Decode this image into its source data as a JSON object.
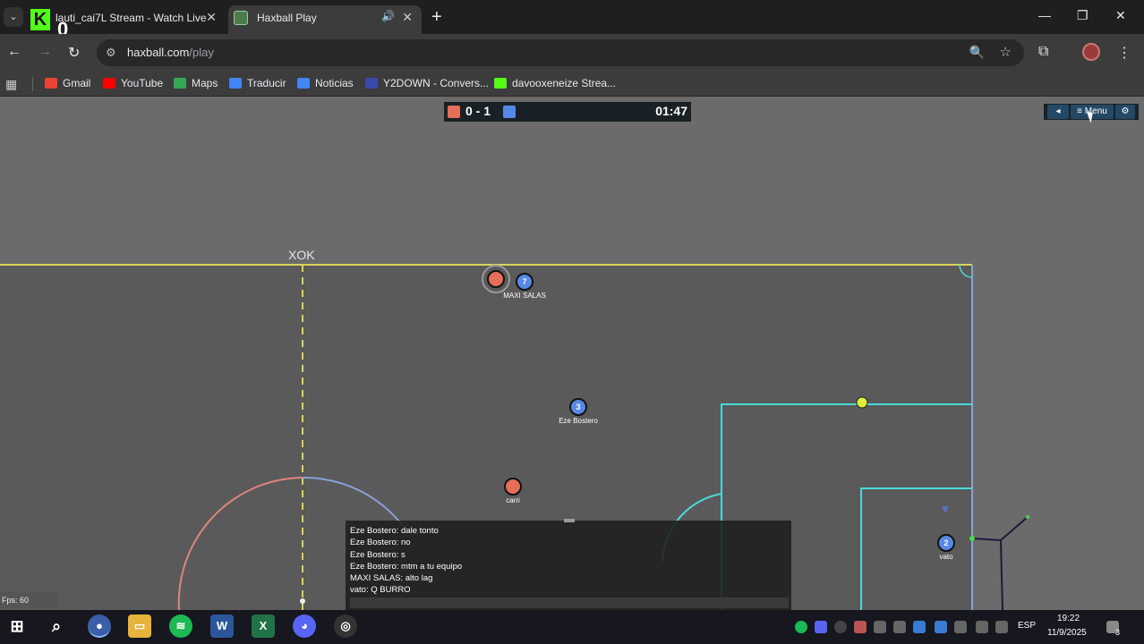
{
  "browser": {
    "tabs": [
      {
        "title": "lauti_cai7L Stream - Watch Live",
        "favicon": "kick-icon",
        "overlay_count": "0"
      },
      {
        "title": "Haxball Play",
        "favicon": "haxball-icon",
        "active": true
      }
    ],
    "address": {
      "domain": "haxball.com",
      "path": "/play"
    },
    "bookmarks": [
      {
        "label": "Gmail",
        "color": "#ea4335"
      },
      {
        "label": "YouTube",
        "color": "#ff0000"
      },
      {
        "label": "Maps",
        "color": "#34a853"
      },
      {
        "label": "Traducir",
        "color": "#4285f4"
      },
      {
        "label": "Noticias",
        "color": "#4285f4"
      },
      {
        "label": "Y2DOWN - Convers...",
        "color": "#3949ab"
      },
      {
        "label": "davooxeneize Strea...",
        "color": "#53fc18"
      }
    ]
  },
  "game": {
    "score": "0 - 1",
    "red_color": "#e56e56",
    "blue_color": "#5689e5",
    "time": "01:47",
    "menu_label": "Menu",
    "fps_label": "Fps: 60",
    "players": [
      {
        "name": "MAXI SALAS",
        "number": "7",
        "team": "blue"
      },
      {
        "name": "Eze Bostero",
        "number": "3",
        "team": "blue"
      },
      {
        "name": "carri",
        "number": "",
        "team": "red"
      },
      {
        "name": "vato",
        "number": "2",
        "team": "blue"
      }
    ],
    "chat": [
      "Eze Bostero: dale tonto",
      "Eze Bostero: no",
      "Eze Bostero: s",
      "Eze Bostero: mtm a tu equipo",
      "MAXI SALAS: alto lag",
      "vato: Q BURRO"
    ]
  },
  "taskbar": {
    "language": "ESP",
    "time": "19:22",
    "date": "11/9/2025",
    "notifications": "3"
  }
}
